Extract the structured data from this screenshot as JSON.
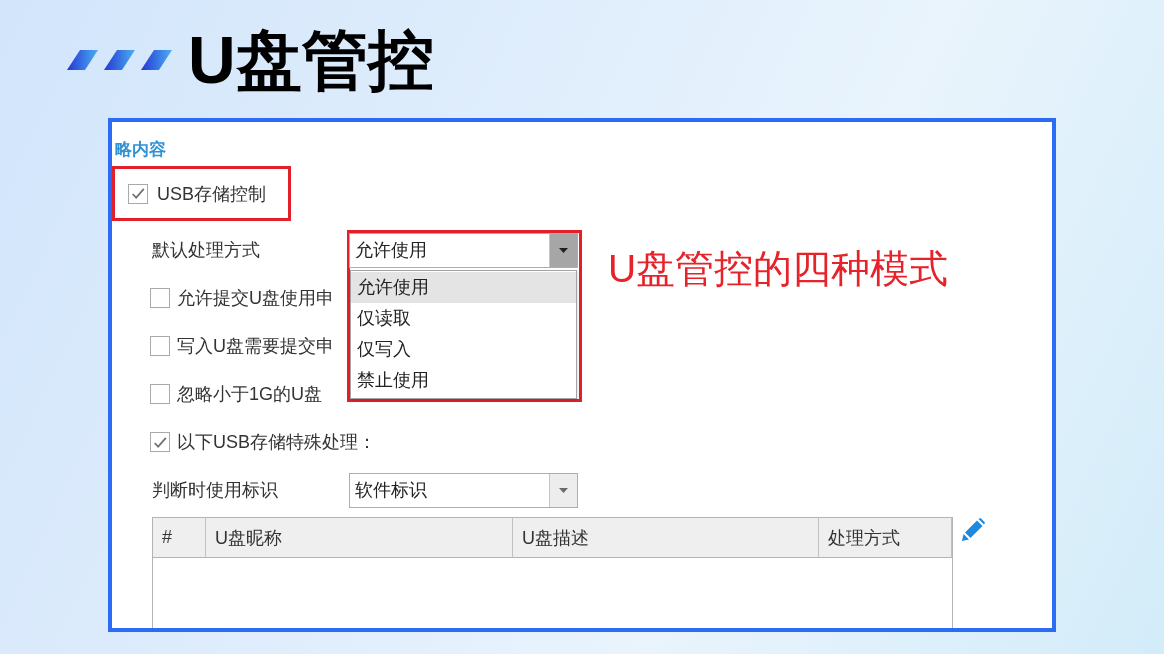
{
  "slide": {
    "title": "U盘管控"
  },
  "panel": {
    "section_title": "略内容",
    "usb_storage_control": {
      "label": "USB存储控制",
      "checked": true,
      "highlighted": true
    },
    "default_action": {
      "label": "默认处理方式",
      "value": "允许使用",
      "expanded": true,
      "highlighted": true,
      "options": [
        {
          "label": "允许使用",
          "selected": true
        },
        {
          "label": "仅读取",
          "selected": false
        },
        {
          "label": "仅写入",
          "selected": false
        },
        {
          "label": "禁止使用",
          "selected": false
        }
      ]
    },
    "options": [
      {
        "label": "允许提交U盘使用申",
        "checked": false
      },
      {
        "label": "写入U盘需要提交申",
        "checked": false
      },
      {
        "label": "忽略小于1G的U盘",
        "checked": false
      },
      {
        "label": "以下USB存储特殊处理：",
        "checked": true
      }
    ],
    "identifier": {
      "label": "判断时使用标识",
      "value": "软件标识",
      "expanded": false
    },
    "table": {
      "columns": [
        "#",
        "U盘昵称",
        "U盘描述",
        "处理方式"
      ]
    }
  },
  "annotation": {
    "text": "U盘管控的四种模式"
  }
}
